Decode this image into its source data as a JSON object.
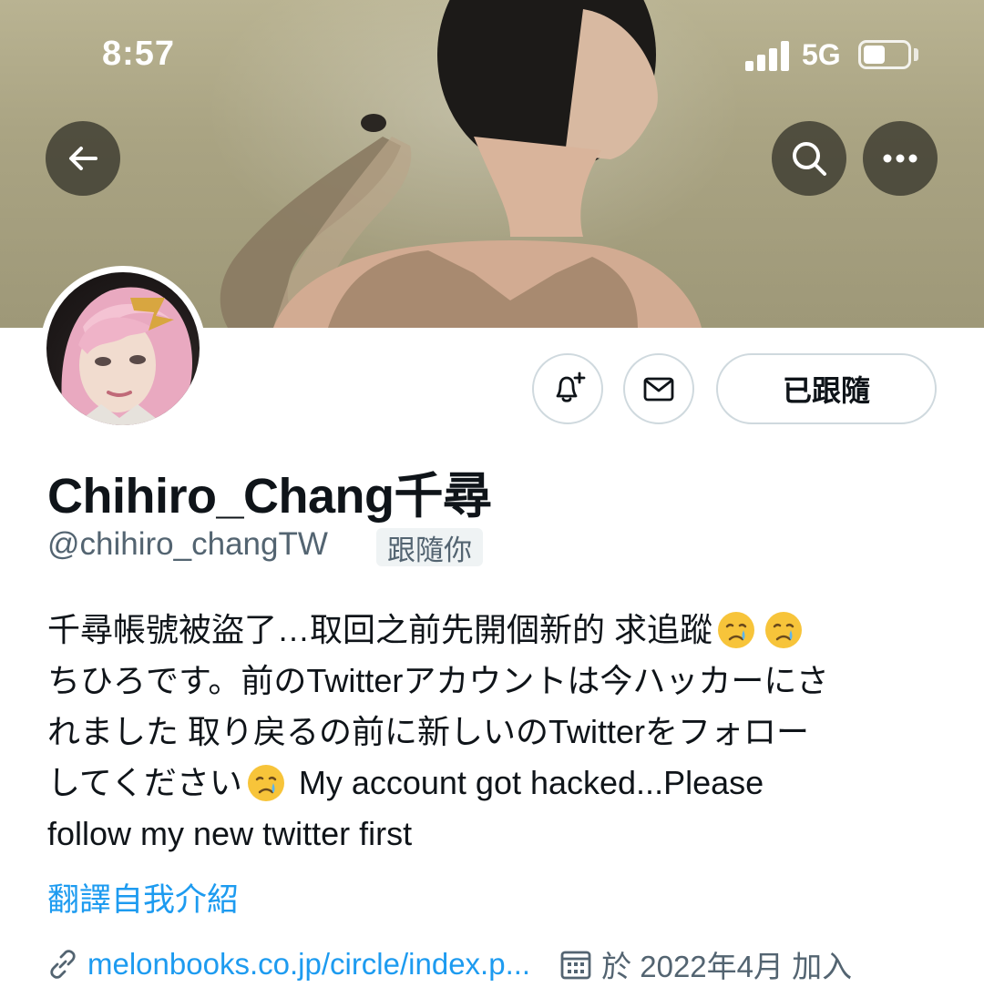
{
  "status_bar": {
    "time": "8:57",
    "network": "5G",
    "battery_level": 0.5
  },
  "header": {
    "back_icon": "arrow-left-icon",
    "search_icon": "search-icon",
    "more_icon": "more-horizontal-icon"
  },
  "profile": {
    "display_name": "Chihiro_Chang千尋",
    "handle": "@chihiro_changTW",
    "follows_you_badge": "跟隨你",
    "actions": {
      "notify_icon": "bell-plus-icon",
      "message_icon": "envelope-icon",
      "follow_label": "已跟隨"
    },
    "bio": {
      "line1": "千尋帳號被盜了…取回之前先開個新的 求追蹤",
      "line2": "ちひろです。前のTwitterアカウントは今ハッカーにさ",
      "line3": "れました 取り戻るの前に新しいのTwitterをフォロー",
      "line4_a": "してください",
      "line4_b": " My account got hacked...Please",
      "line5": "follow my new twitter first",
      "emoji": "crying-face-emoji"
    },
    "translate_label": "翻譯自我介紹",
    "website": "melonbooks.co.jp/circle/index.p...",
    "joined": "於 2022年4月 加入"
  },
  "colors": {
    "link": "#1d9bf0",
    "secondary_text": "#536471",
    "primary_text": "#0f1419",
    "border": "#cfd9de"
  }
}
